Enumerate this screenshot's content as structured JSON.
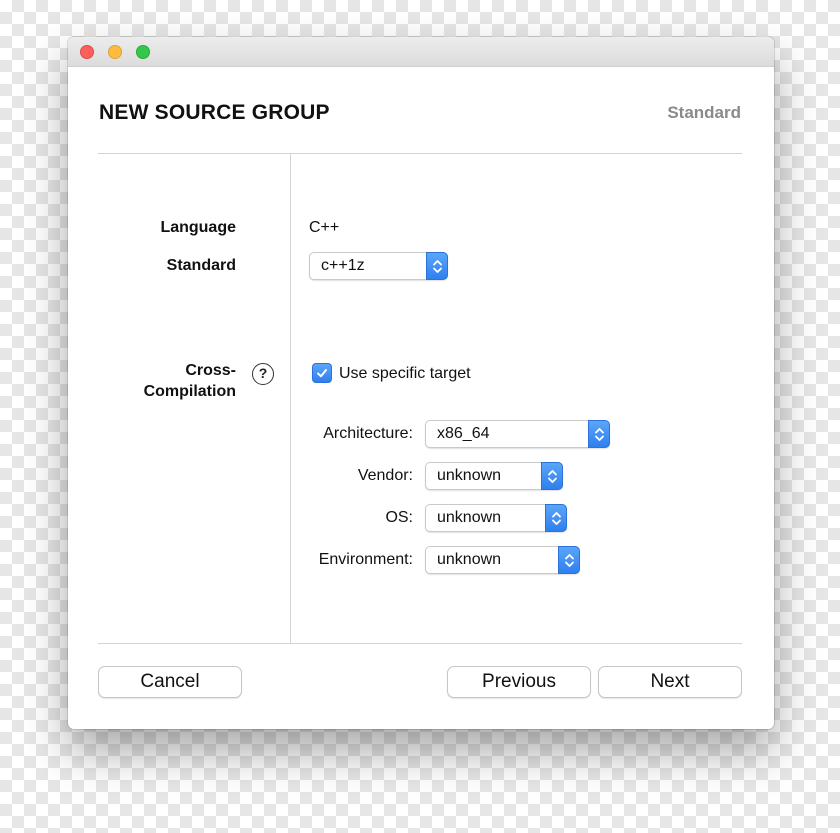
{
  "header": {
    "title": "NEW SOURCE GROUP",
    "step": "Standard"
  },
  "form": {
    "language_label": "Language",
    "language_value": "C++",
    "standard_label": "Standard",
    "standard_value": "c++1z",
    "cross_label_line1": "Cross-",
    "cross_label_line2": "Compilation",
    "help_glyph": "?",
    "use_target_label": "Use specific target",
    "use_target_checked": true,
    "architecture_label": "Architecture:",
    "architecture_value": "x86_64",
    "vendor_label": "Vendor:",
    "vendor_value": "unknown",
    "os_label": "OS:",
    "os_value": "unknown",
    "environment_label": "Environment:",
    "environment_value": "unknown"
  },
  "buttons": {
    "cancel": "Cancel",
    "previous": "Previous",
    "next": "Next"
  },
  "colors": {
    "accent": "#2f7ff0",
    "close": "#fc605c",
    "minimize": "#fdbc40",
    "maximize": "#34c84a",
    "step_text": "#8a8a8a"
  },
  "icons": {
    "popup": "chevron-up-down-icon",
    "help": "question-circle-icon",
    "checkbox": "checkmark-icon"
  }
}
